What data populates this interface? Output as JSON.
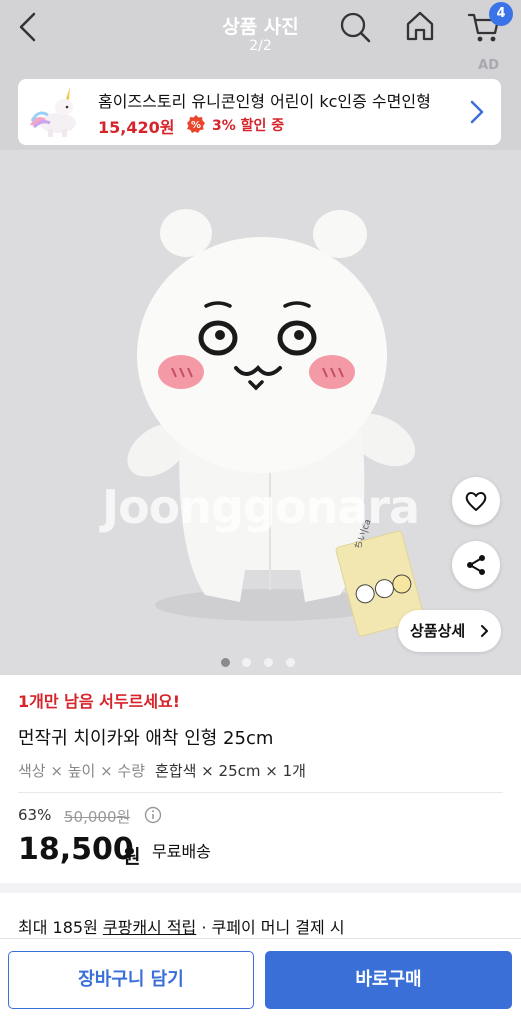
{
  "header": {
    "title": "상품 사진",
    "page_indicator": "2/2",
    "cart_count": "4",
    "ad_label": "AD"
  },
  "ad": {
    "title": "홈이즈스토리 유니콘인형 어린이 kc인증 수면인형",
    "price": "15,420원",
    "discount": "3% 할인 중"
  },
  "image": {
    "watermark": "Joonggonara",
    "tag_text": "ちい|ca",
    "detail_button": "상품상세",
    "dots_total": 4,
    "dots_active": 1
  },
  "product": {
    "stock_warning": "1개만 남음 서두르세요!",
    "title": "먼작귀 치이카와 애착 인형 25cm",
    "option_label": "색상 × 높이 × 수량",
    "option_value": "혼합색 × 25cm × 1개",
    "discount_rate": "63%",
    "original_price": "50,000원",
    "sale_price": "18,500",
    "sale_unit": "원",
    "shipping": "무료배송",
    "cash_prefix": "최대 185원 ",
    "cash_link": "쿠팡캐시 적립",
    "cash_suffix": " · 쿠페이 머니 결제 시"
  },
  "actions": {
    "cart_label": "장바구니 담기",
    "buy_label": "바로구매"
  },
  "colors": {
    "accent": "#3a6fd8",
    "sale_red": "#d6242a",
    "header_bg": "#d3d3d6"
  }
}
